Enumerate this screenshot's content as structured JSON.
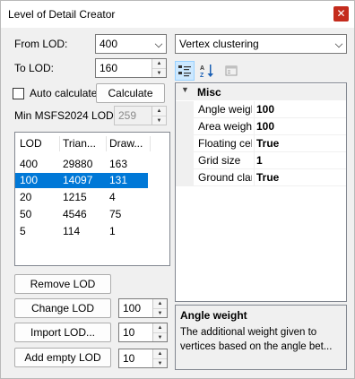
{
  "window": {
    "title": "Level of Detail Creator",
    "close_glyph": "✕"
  },
  "from_lod": {
    "label": "From LOD:",
    "value": "400"
  },
  "method": {
    "value": "Vertex clustering"
  },
  "to_lod": {
    "label": "To LOD:",
    "value": "160"
  },
  "auto_calculate": {
    "label": "Auto calculate",
    "checked": false
  },
  "calculate_button": "Calculate",
  "min_msfs": {
    "label": "Min MSFS2024 LOD:",
    "value": "259"
  },
  "lod_list": {
    "columns": [
      "LOD",
      "Trian...",
      "Draw..."
    ],
    "rows": [
      {
        "lod": "400",
        "triangles": "29880",
        "draws": "163",
        "selected": false
      },
      {
        "lod": "100",
        "triangles": "14097",
        "draws": "131",
        "selected": true
      },
      {
        "lod": "20",
        "triangles": "1215",
        "draws": "4",
        "selected": false
      },
      {
        "lod": "50",
        "triangles": "4546",
        "draws": "75",
        "selected": false
      },
      {
        "lod": "5",
        "triangles": "114",
        "draws": "1",
        "selected": false
      }
    ]
  },
  "buttons": {
    "remove": "Remove LOD",
    "change": "Change LOD",
    "import": "Import LOD...",
    "add_empty": "Add empty LOD"
  },
  "spinners": {
    "change": "100",
    "import": "10",
    "add_empty": "10"
  },
  "toolbar": {
    "categorized_icon": "categorized-icon",
    "alphabetical_icon": "alphabetical-sort-icon",
    "property_pages_icon": "property-pages-icon"
  },
  "property_grid": {
    "category": "Misc",
    "rows": [
      {
        "name": "Angle weight",
        "value": "100"
      },
      {
        "name": "Area weight",
        "value": "100"
      },
      {
        "name": "Floating cell",
        "value": "True"
      },
      {
        "name": "Grid size",
        "value": "1"
      },
      {
        "name": "Ground clamp",
        "value": "True"
      }
    ]
  },
  "description": {
    "title": "Angle weight",
    "text": "The additional weight given to vertices based on the angle bet..."
  },
  "colors": {
    "selection": "#0078d7",
    "close_button": "#c42b1c",
    "toolbar_active": "#cce8ff"
  }
}
